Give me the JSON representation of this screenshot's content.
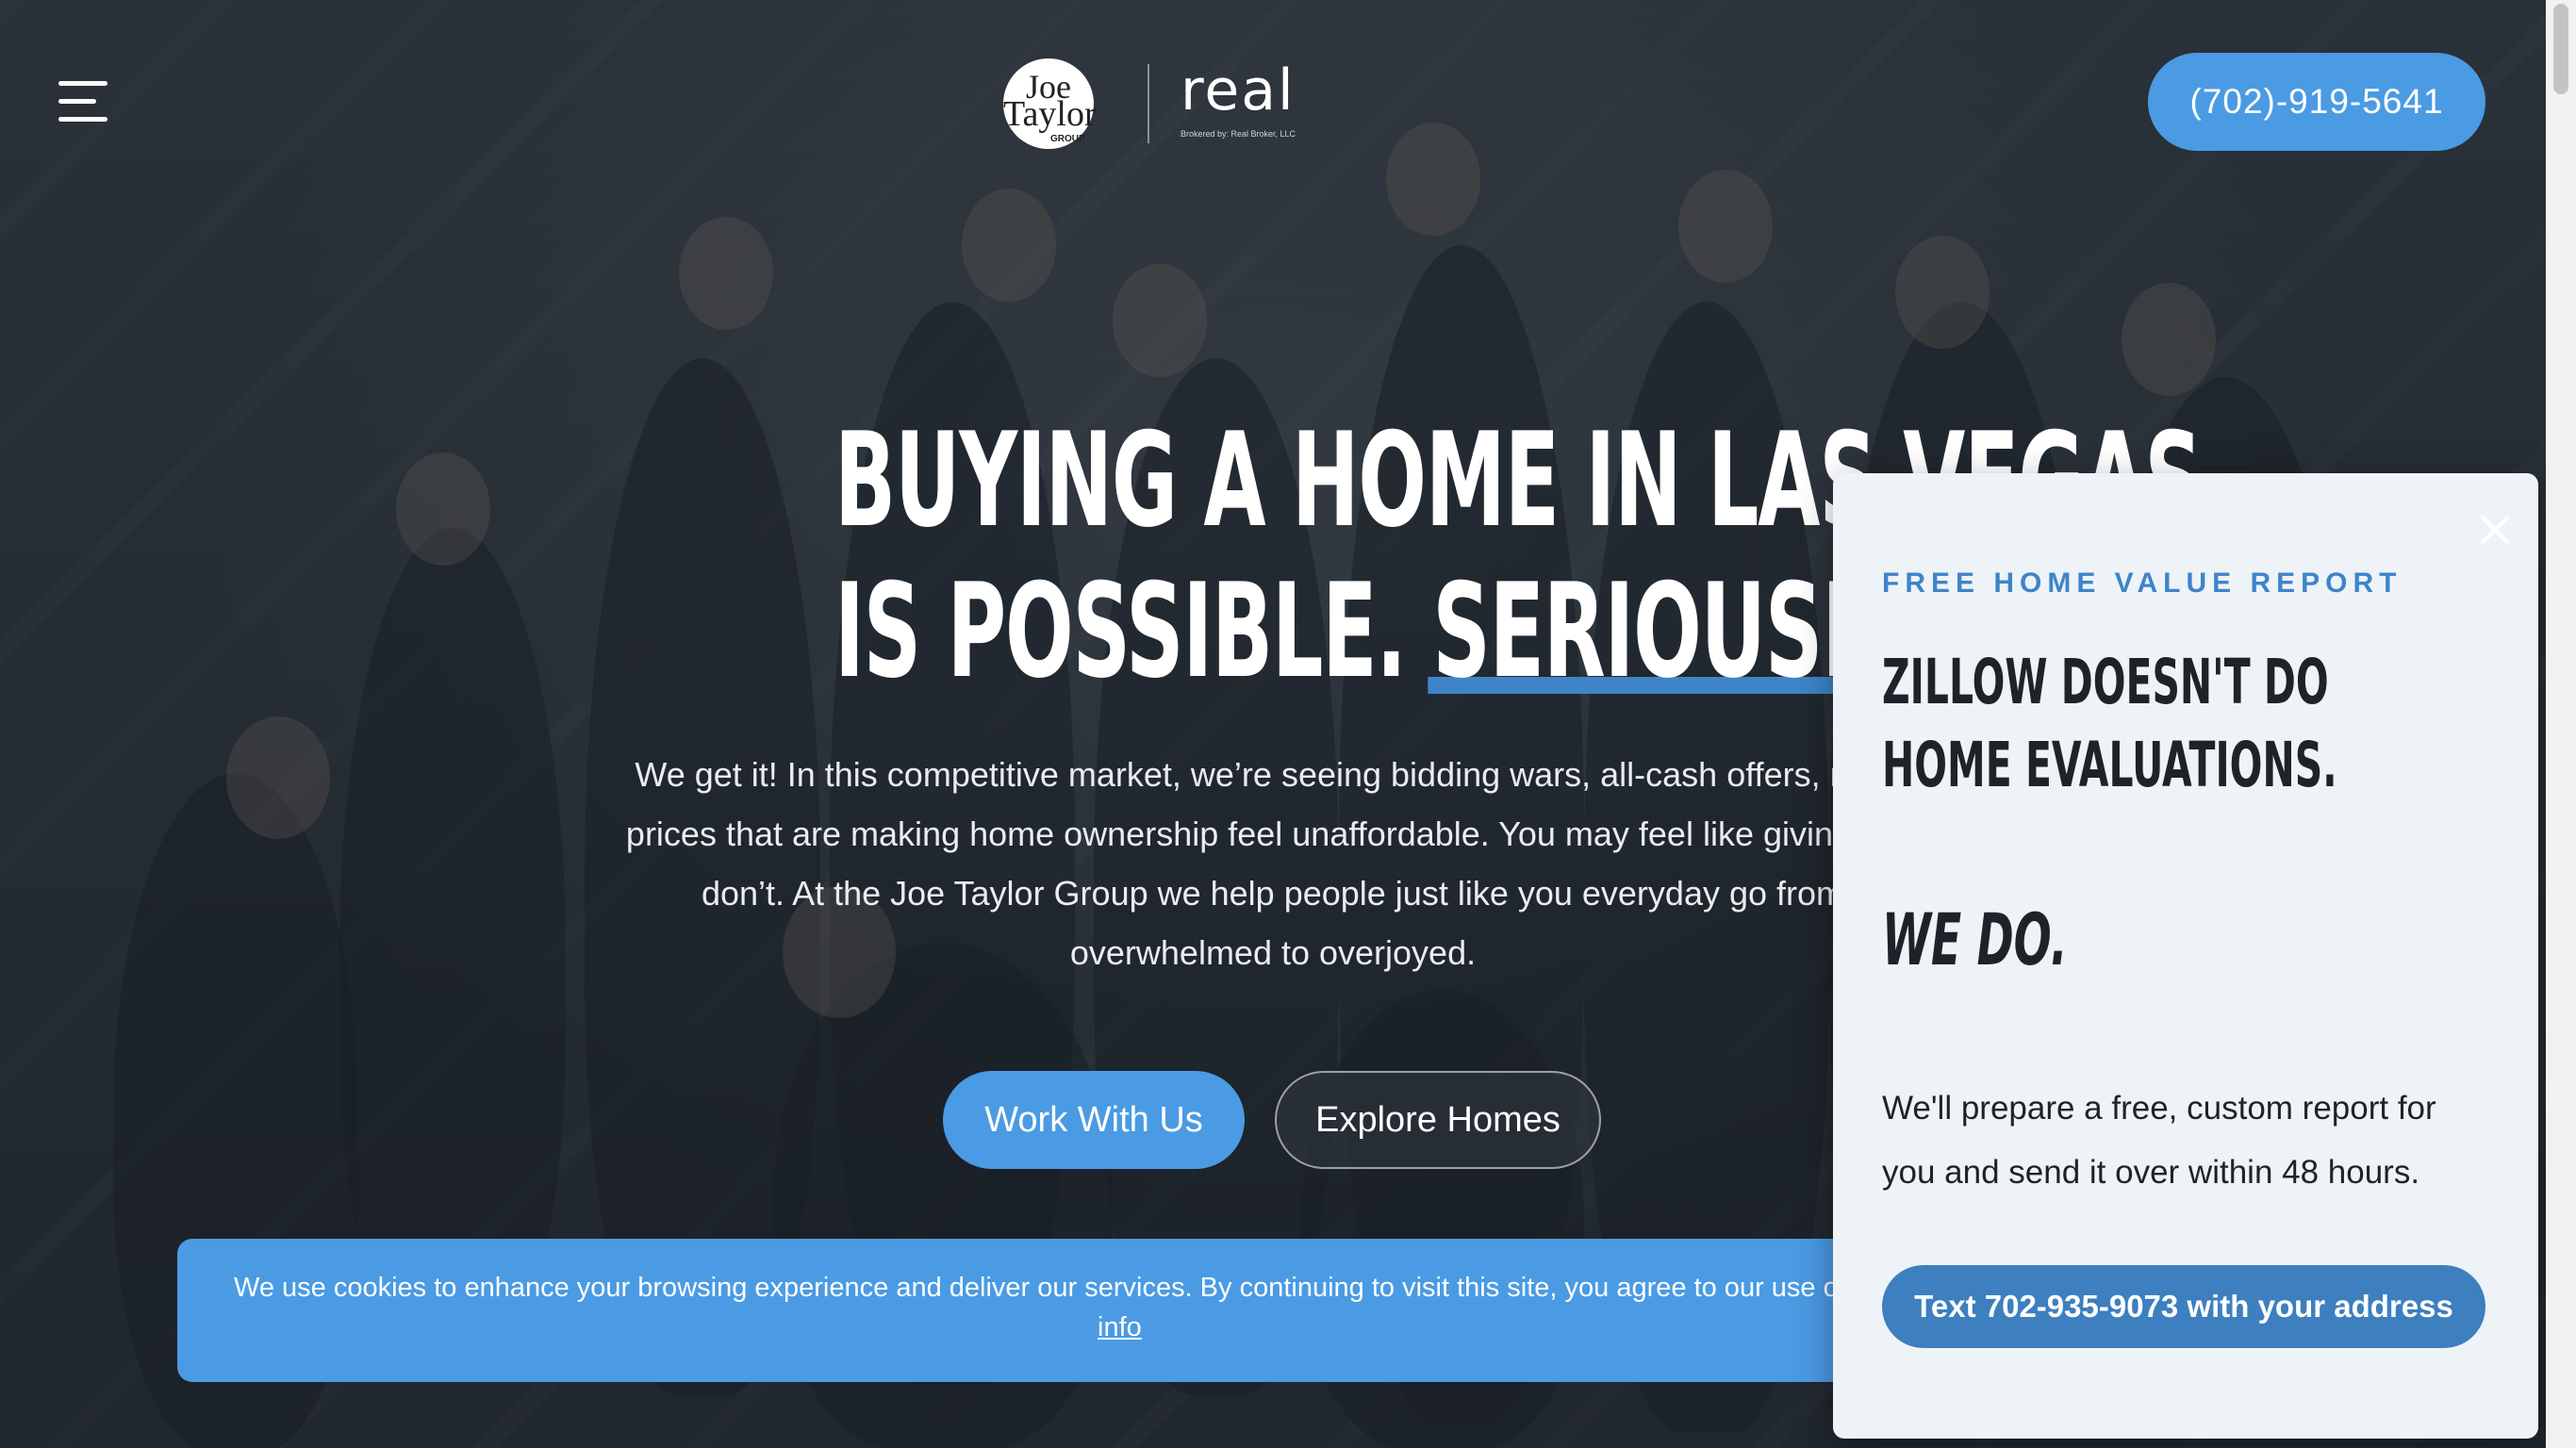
{
  "header": {
    "menu_icon": "hamburger-menu-icon",
    "logo": {
      "brand_line1": "Joe",
      "brand_line2": "Taylor",
      "brand_group": "GROUP",
      "partner": "real",
      "partner_sub": "Brokered by: Real Broker, LLC"
    },
    "phone": "(702)-919-5641"
  },
  "hero": {
    "headline_line1": "BUYING A HOME IN LAS VEGAS",
    "headline_line2_a": "IS POSSIBLE. ",
    "headline_line2_b": "SERIOUSLY",
    "headline_line2_c": ".",
    "paragraph": "We get it! In this competitive market, we’re seeing bidding wars, all-cash offers, rising prices that are making home ownership feel unaffordable. You may feel like giving up - don’t. At the Joe Taylor Group we help people just like you everyday go from overwhelmed to overjoyed.",
    "primary_button": "Work With Us",
    "secondary_button": "Explore Homes"
  },
  "cookie_banner": {
    "text": "We use cookies to enhance your browsing experience and deliver our services. By continuing to visit this site, you agree to our use of cookies.",
    "link": "info"
  },
  "popup": {
    "close_icon": "close-icon",
    "kicker": "FREE HOME VALUE REPORT",
    "title_line1": "ZILLOW DOESN'T DO",
    "title_line2": "HOME EVALUATIONS.",
    "emphasis": "WE DO.",
    "description": "We'll prepare a free, custom report for you and send it over within 48 hours.",
    "cta": "Text 702-935-9073 with your address"
  },
  "colors": {
    "accent": "#4a9be3",
    "popup_bg": "#eef3f8",
    "dark_text": "#1f2329"
  }
}
